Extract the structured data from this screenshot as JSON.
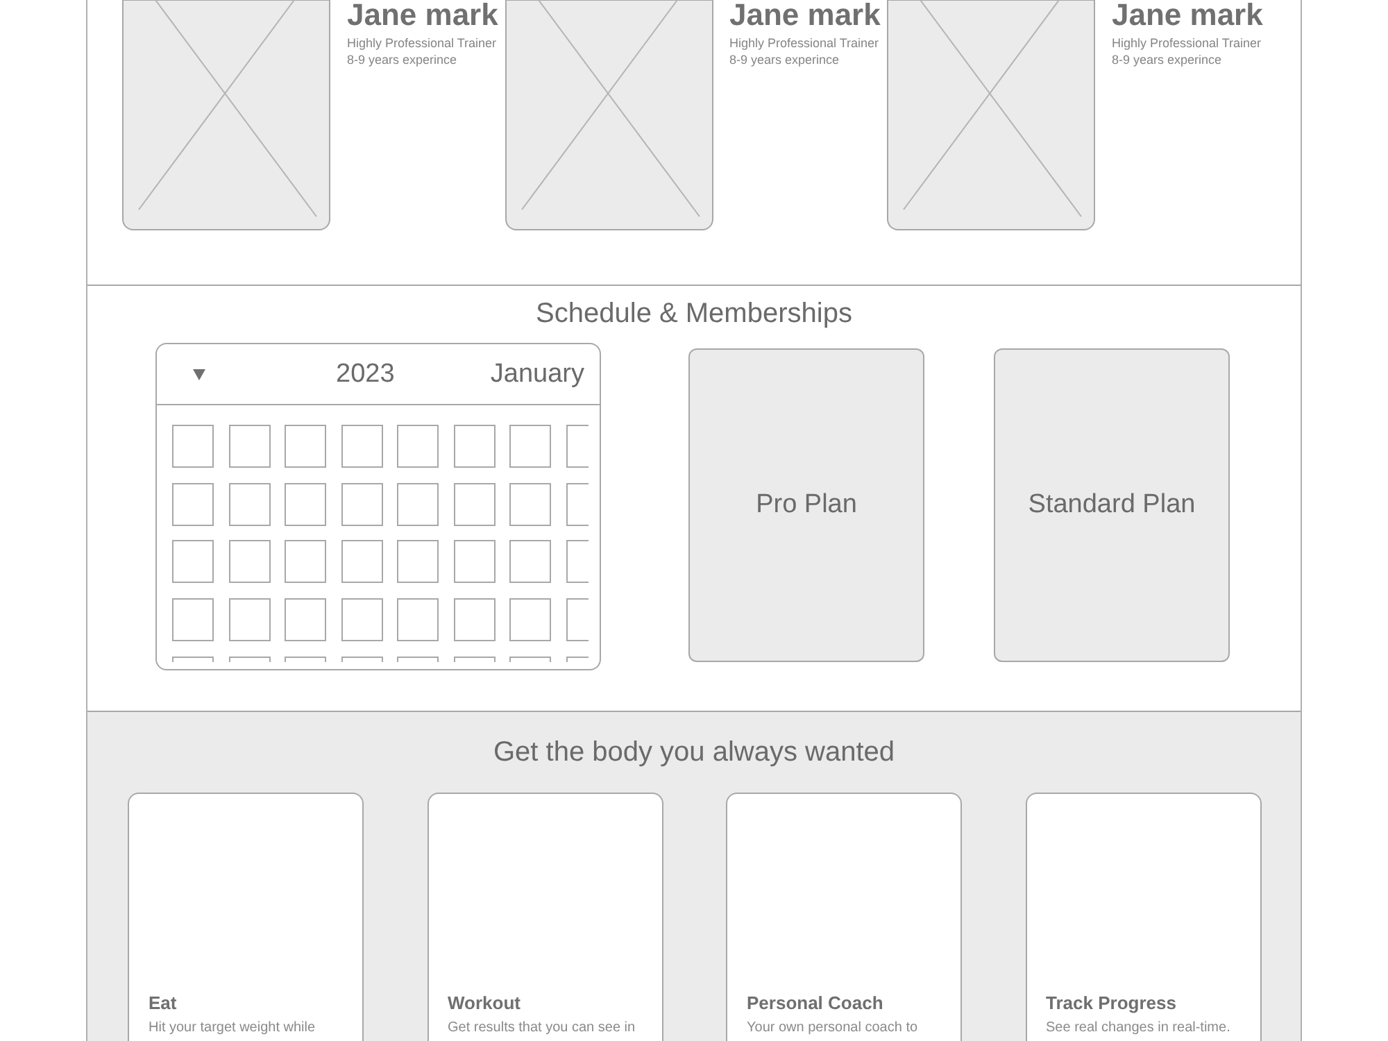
{
  "trainers": [
    {
      "name": "Jane mark",
      "title": "Highly Professional Trainer",
      "experience": "8-9 years experince"
    },
    {
      "name": "Jane mark",
      "title": "Highly Professional Trainer",
      "experience": "8-9 years experince"
    },
    {
      "name": "Jane mark",
      "title": "Highly Professional Trainer",
      "experience": "8-9 years experince"
    }
  ],
  "schedule": {
    "title": "Schedule & Memberships",
    "calendar": {
      "year": "2023",
      "month": "January"
    },
    "plans": [
      {
        "name": "Pro Plan"
      },
      {
        "name": "Standard Plan"
      }
    ]
  },
  "features": {
    "title": "Get the body you always wanted",
    "cards": [
      {
        "title": "Eat",
        "description": "Hit your target weight while"
      },
      {
        "title": "Workout",
        "description": "Get results that you can see in"
      },
      {
        "title": "Personal Coach",
        "description": "Your own personal coach to"
      },
      {
        "title": "Track Progress",
        "description": "See real changes in real-time."
      }
    ]
  }
}
